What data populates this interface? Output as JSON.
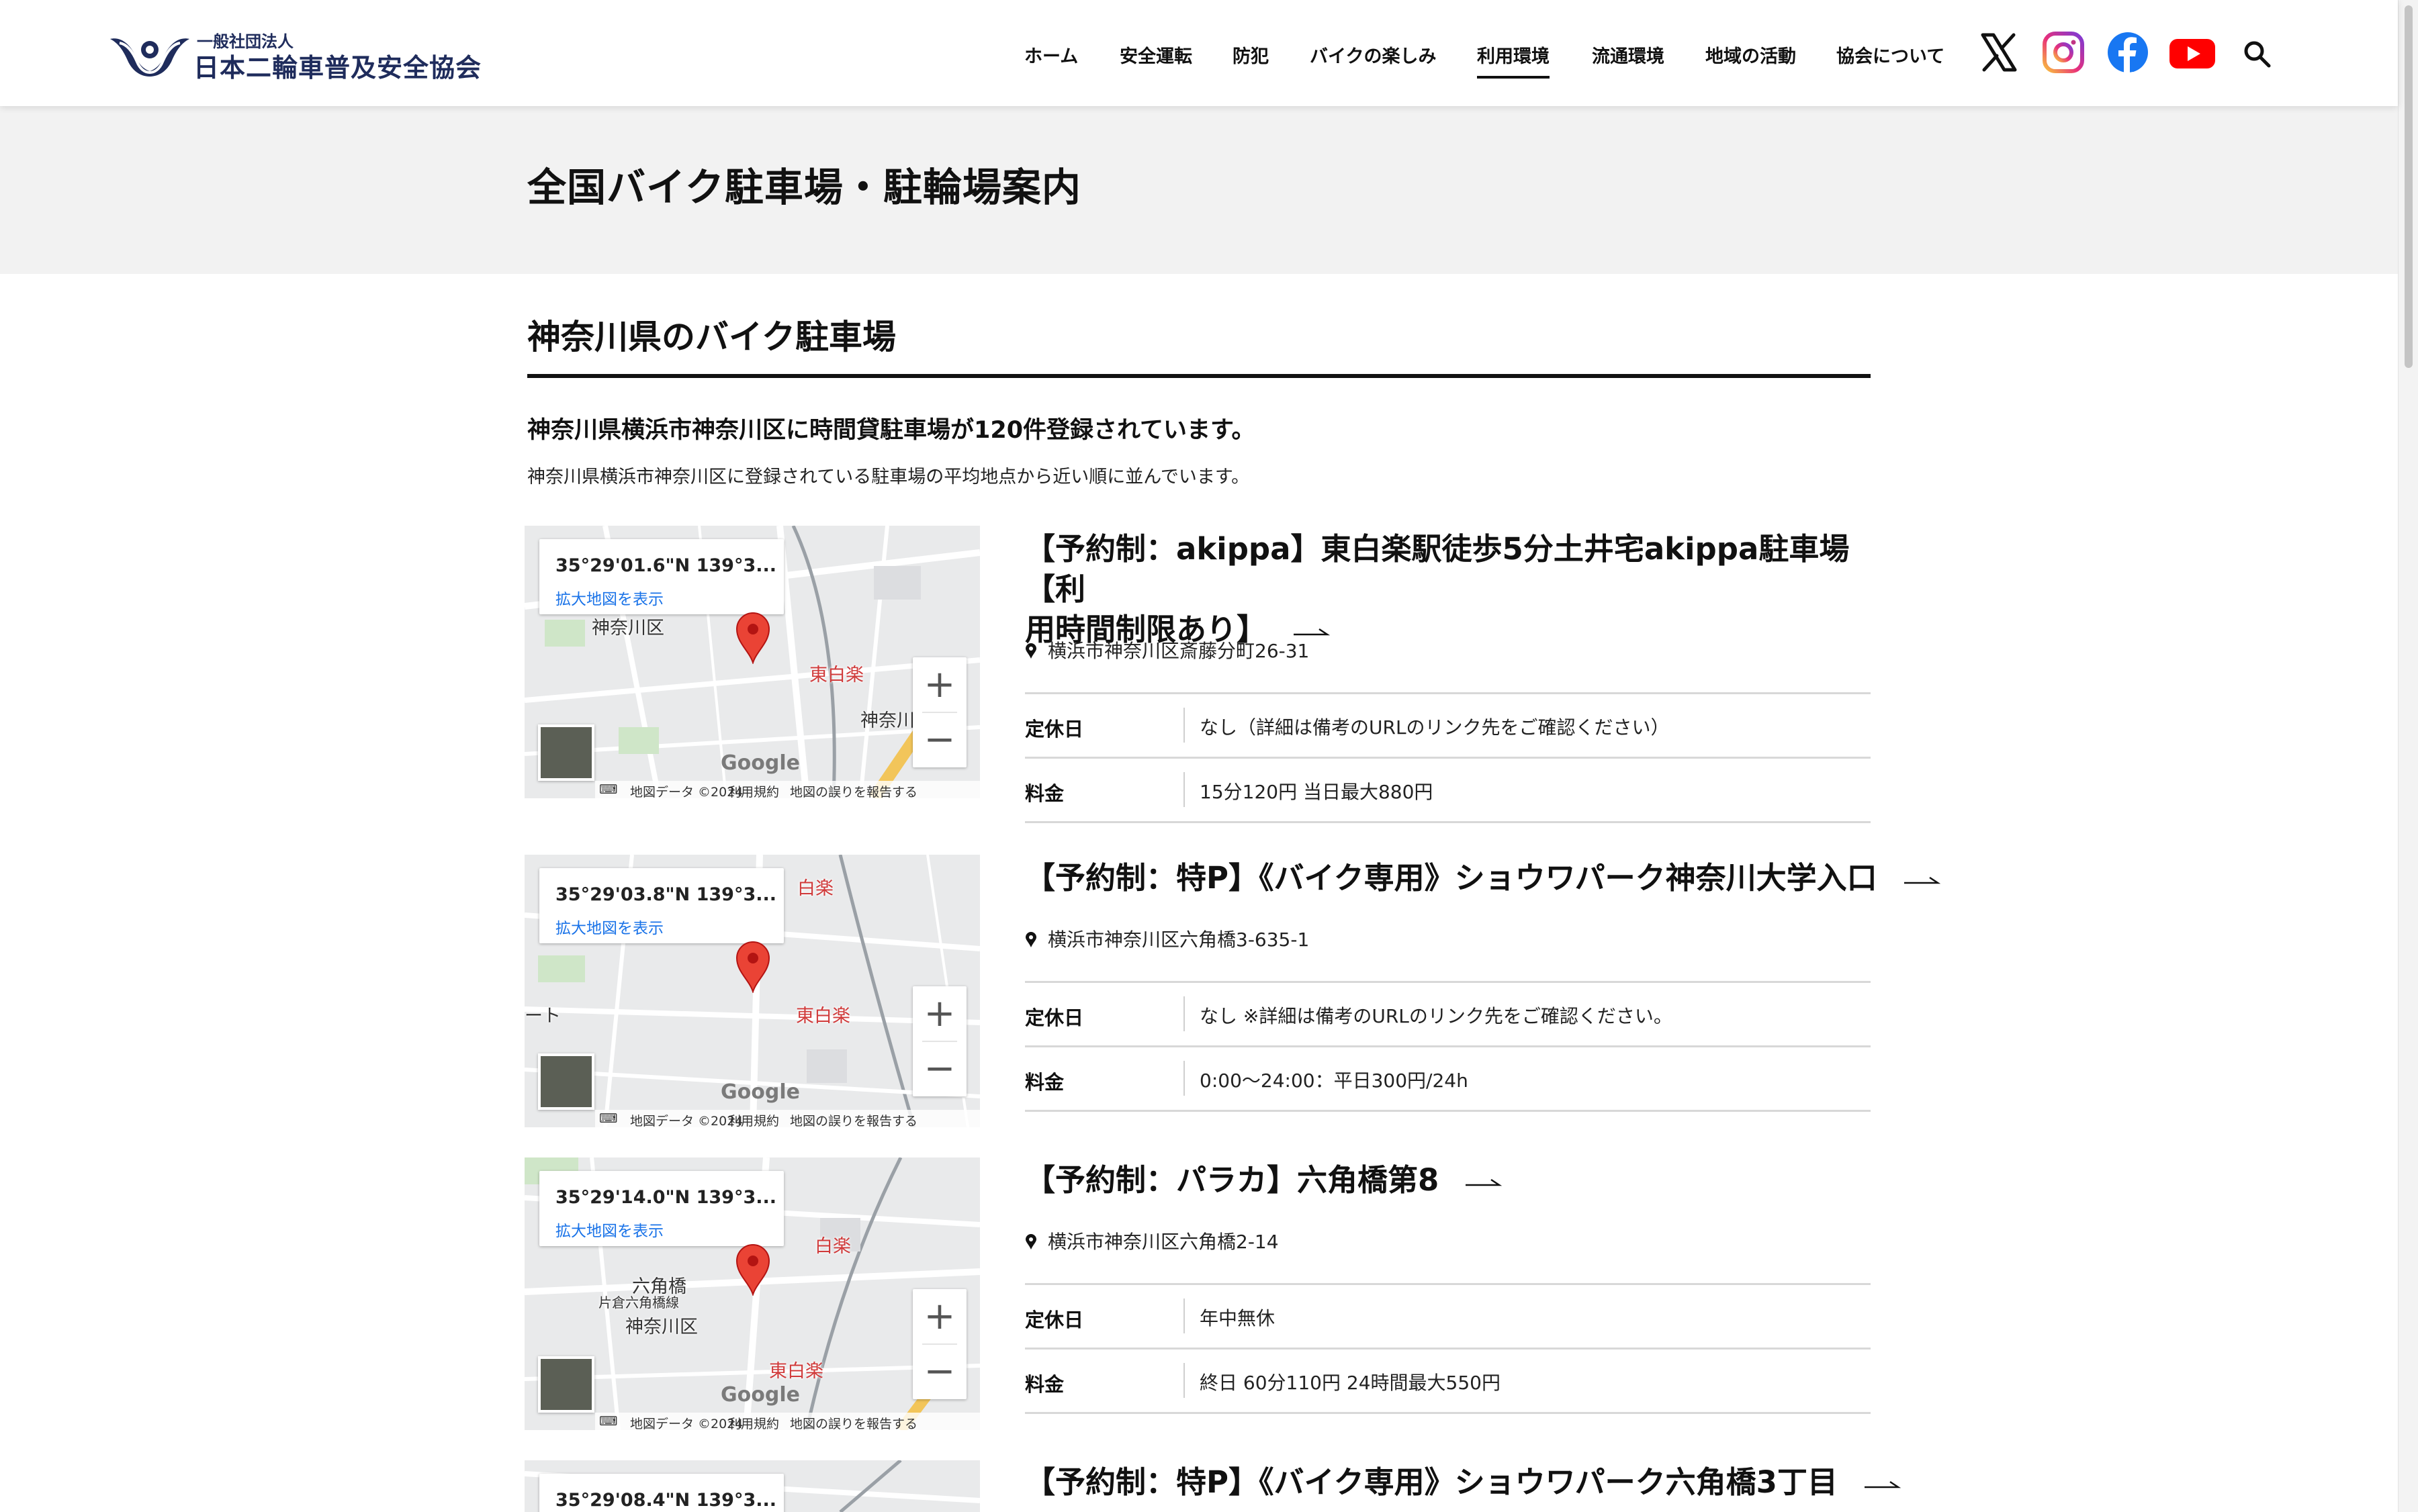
{
  "header": {
    "logo_sub": "一般社団法人",
    "logo_main": "日本二輪車普及安全協会",
    "nav": [
      {
        "label": "ホーム"
      },
      {
        "label": "安全運転"
      },
      {
        "label": "防犯"
      },
      {
        "label": "バイクの楽しみ"
      },
      {
        "label": "利用環境",
        "active": true
      },
      {
        "label": "流通環境"
      },
      {
        "label": "地域の活動"
      },
      {
        "label": "協会について"
      }
    ],
    "social_icons": [
      "x-icon",
      "instagram-icon",
      "facebook-icon",
      "youtube-icon"
    ],
    "search_icon": "search-icon"
  },
  "page": {
    "title": "全国バイク駐車場・駐輪場案内",
    "section_title": "神奈川県のバイク駐車場",
    "lead": "神奈川県横浜市神奈川区に時間貸駐車場が120件登録されています。",
    "sub": "神奈川県横浜市神奈川区に登録されている駐車場の平均地点から近い順に並んでいます。"
  },
  "map_common": {
    "enlarge_link": "拡大地図を表示",
    "zoom_in": "+",
    "zoom_out": "−",
    "google": "Google",
    "footer_data": "地図データ ©2024",
    "footer_terms": "利用規約",
    "footer_report": "地図の誤りを報告する"
  },
  "labels": {
    "holiday": "定休日",
    "fee": "料金"
  },
  "listings": [
    {
      "title_line1": "【予約制：akippa】東白楽駅徒歩5分土井宅akippa駐車場【利",
      "title_line2": "用時間制限あり】",
      "address": "横浜市神奈川区斎藤分町26-31",
      "holiday": "なし（詳細は備考のURLのリンク先をご確認ください）",
      "fee": "15分120円 当日最大880円",
      "map": {
        "coord": "35°29'01.6\"N 139°3...",
        "labels": [
          "神奈川区",
          "東白楽",
          "神奈川",
          "神奈川大"
        ]
      }
    },
    {
      "title_line1": "【予約制：特P】《バイク専用》ショウワパーク神奈川大学入口",
      "title_line2": "",
      "address": "横浜市神奈川区六角橋3-635-1",
      "holiday": "なし ※詳細は備考のURLのリンク先をご確認ください。",
      "fee": "0:00〜24:00：平日300円/24h",
      "map": {
        "coord": "35°29'03.8\"N 139°3...",
        "labels": [
          "白楽",
          "東白楽",
          "ート"
        ]
      }
    },
    {
      "title_line1": "【予約制：パラカ】六角橋第8",
      "title_line2": "",
      "address": "横浜市神奈川区六角橋2-14",
      "holiday": "年中無休",
      "fee": "終日 60分110円 24時間最大550円",
      "map": {
        "coord": "35°29'14.0\"N 139°3...",
        "labels": [
          "白楽",
          "六角橋",
          "片倉六角橋線",
          "神奈川区",
          "東白楽"
        ]
      }
    },
    {
      "title_line1": "【予約制：特P】《バイク専用》ショウワパーク六角橋3丁目",
      "title_line2": "",
      "map": {
        "coord": "35°29'08.4\"N 139°3..."
      }
    }
  ]
}
